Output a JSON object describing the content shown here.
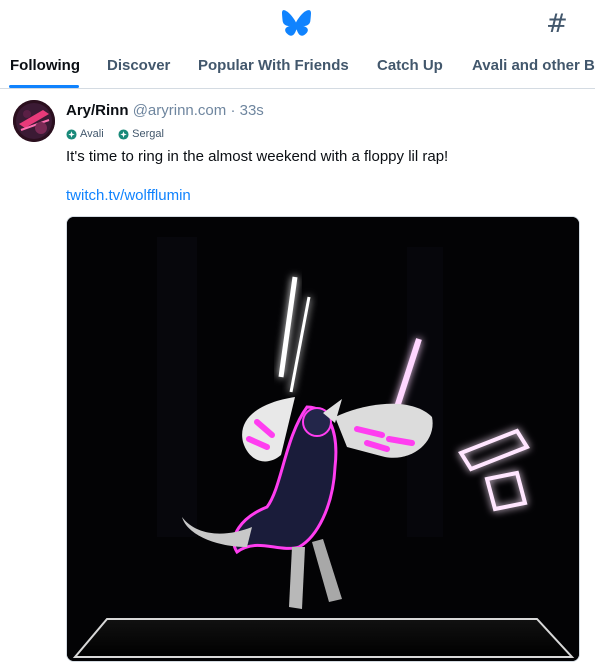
{
  "header": {
    "logo_icon": "butterfly-icon",
    "feeds_icon": "hash-icon",
    "feeds_glyph": "#",
    "brand_color": "#1083fe"
  },
  "tabs": [
    {
      "label": "Following",
      "active": true
    },
    {
      "label": "Discover",
      "active": false
    },
    {
      "label": "Popular With Friends",
      "active": false
    },
    {
      "label": "Catch Up",
      "active": false
    },
    {
      "label": "Avali and other Bi",
      "active": false
    }
  ],
  "post": {
    "author_name": "Ary/Rinn",
    "handle": "@aryrinn.com",
    "separator": "·",
    "time": "33s",
    "labels": [
      {
        "text": "Avali",
        "icon": "label-badge-icon"
      },
      {
        "text": "Sergal",
        "icon": "label-badge-icon"
      }
    ],
    "text": "It's time to ring in the almost weekend with a floppy lil rap!",
    "link": "twitch.tv/wolfflumin"
  }
}
